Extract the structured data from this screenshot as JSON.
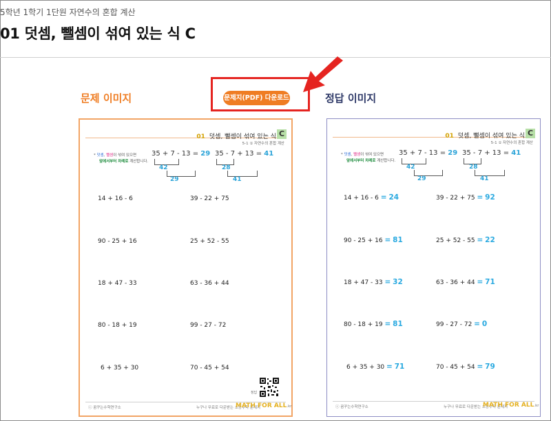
{
  "header": {
    "breadcrumb": "5학년 1학기 1단원 자연수의 혼합 계산",
    "title": "01 덧셈, 뺄셈이 섞여 있는 식 C"
  },
  "labels": {
    "problem_image": "문제 이미지",
    "answer_image": "정답 이미지",
    "download_button": "문제지(PDF) 다운로드"
  },
  "colors": {
    "accent_orange": "#ef7d23",
    "answer_navy": "#2c3766",
    "highlight_red": "#e52420",
    "answer_blue": "#29a9e0"
  },
  "worksheet": {
    "number": "01",
    "title": "덧셈, 뺄셈이 섞여 있는 식",
    "badge": "C",
    "subtitle": "5-1 ① 자연수의 혼합 계산",
    "instruction_line1_a": "덧셈",
    "instruction_line1_sep": ", ",
    "instruction_line1_b": "뺄셈",
    "instruction_line1_rest": "이 섞여 있으면",
    "instruction_line2_hl": "앞에서부터 차례로",
    "instruction_line2_rest": " 계산합니다.",
    "example1": {
      "expr": "35 + 7 - 13 = ",
      "answer": "29",
      "step1": "42",
      "step2": "29"
    },
    "example2": {
      "expr": "35 - 7 + 13 = ",
      "answer": "41",
      "step1": "28",
      "step2": "41"
    },
    "qr_label": "정답",
    "footer_left": "ⓒ 꿈꾸는수학연구소",
    "footer_right": "누구나 무료로 다운받는 초등수학 문제지",
    "brand": "MATH FOR ALL",
    "brand_suffix": ".kr"
  },
  "problems": [
    {
      "expr": "14 + 16 - 6",
      "answer": "24"
    },
    {
      "expr": "39 - 22 + 75",
      "answer": "92"
    },
    {
      "expr": "90 - 25 + 16",
      "answer": "81"
    },
    {
      "expr": "25 + 52 - 55",
      "answer": "22"
    },
    {
      "expr": "18 + 47 - 33",
      "answer": "32"
    },
    {
      "expr": "63 - 36 + 44",
      "answer": "71"
    },
    {
      "expr": "80 - 18 + 19",
      "answer": "81"
    },
    {
      "expr": "99 - 27 - 72",
      "answer": "0"
    },
    {
      "expr": "6 + 35 + 30",
      "answer": "71"
    },
    {
      "expr": "70 - 45 + 54",
      "answer": "79"
    }
  ],
  "equals_sign": "="
}
